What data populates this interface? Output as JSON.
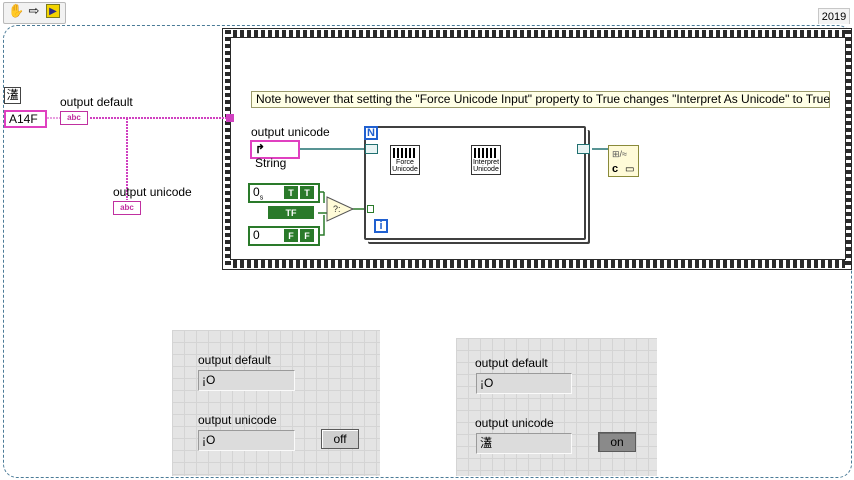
{
  "toolbar": {
    "icons": [
      "hand-icon",
      "arrow-icon",
      "run-icon"
    ]
  },
  "year": "2019",
  "note": "Note however that setting the \"Force Unicode Input\" property to True changes \"Interpret As Unicode\" to True",
  "controls": {
    "unicode_glyph": "濭",
    "hex_value": "A14F",
    "output_default_label": "output default",
    "output_unicode_label": "output unicode",
    "abc_text": "abc",
    "string_ref": "String",
    "loop_count": "N",
    "loop_index": "i",
    "bool_true": "T",
    "bool_false": "F",
    "num_top": "0",
    "num_top_sub": "s",
    "num_bottom": "0",
    "tf_text": "TF"
  },
  "nodes": {
    "force_unicode": "Force Unicode",
    "interpret_unicode": "Interpret Unicode",
    "concat_label": "c"
  },
  "panel_left": {
    "output_default_label": "output default",
    "output_default_value": "¡O",
    "output_unicode_label": "output unicode",
    "output_unicode_value": "¡O",
    "button": "off"
  },
  "panel_right": {
    "output_default_label": "output default",
    "output_default_value": "¡O",
    "output_unicode_label": "output unicode",
    "output_unicode_value": "濭",
    "button": "on"
  },
  "colors": {
    "string_wire": "#d040c0",
    "bool_wire": "#2a7a2a",
    "ref_wire": "#207070",
    "frame": "#4a7b97"
  }
}
